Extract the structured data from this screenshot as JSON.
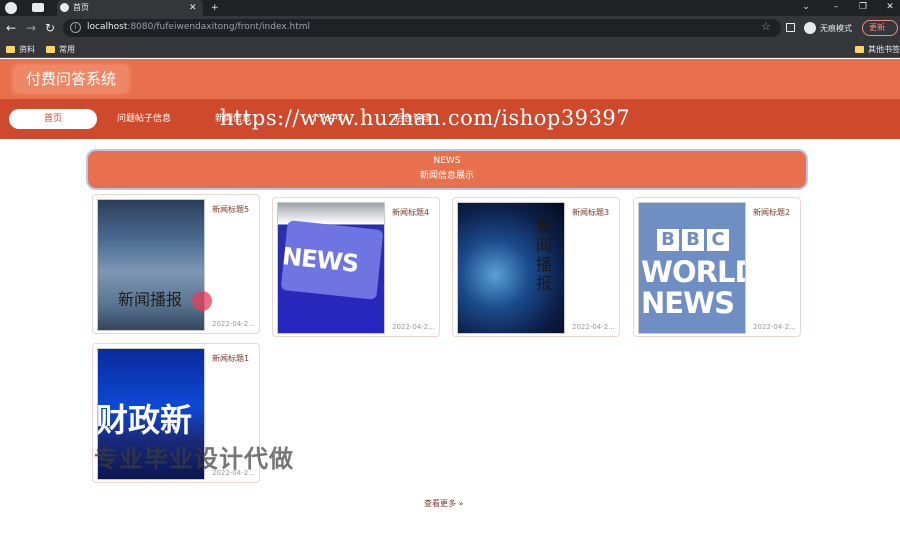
{
  "browser": {
    "tab_title": "首页",
    "url_host": "localhost",
    "url_rest": ":8080/fufeiwendaxitong/front/index.html",
    "incognito_label": "无痕模式",
    "update_label": "更新",
    "bookmarks": [
      "资料",
      "常用"
    ],
    "other_bookmarks": "其他书签"
  },
  "site": {
    "logo": "付费问答系统",
    "nav": [
      "首页",
      "问题帖子信息",
      "新闻信息",
      "个人中心",
      "后台管理"
    ],
    "watermark": "https://www.huzhan.com/ishop39397"
  },
  "news_section": {
    "title_en": "NEWS",
    "title_cn": "新闻信息展示",
    "items": [
      {
        "title": "新闻标题5",
        "date": "2022-04-2...",
        "image_caption": "新闻播报"
      },
      {
        "title": "新闻标题4",
        "date": "2022-04-2...",
        "image_caption": "NEWS"
      },
      {
        "title": "新闻标题3",
        "date": "2022-04-2...",
        "image_caption": "新闻播报"
      },
      {
        "title": "新闻标题2",
        "date": "2022-04-2...",
        "image_caption": "BBC WORLD NEWS"
      },
      {
        "title": "新闻标题1",
        "date": "2022-04-2...",
        "image_caption": "财政新"
      }
    ],
    "more": "查看更多 »"
  },
  "overlay": "专业毕业设计代做",
  "colors": {
    "header": "#e9704d",
    "navbar": "#cf4a2c",
    "card_title": "#7a3a2a"
  }
}
